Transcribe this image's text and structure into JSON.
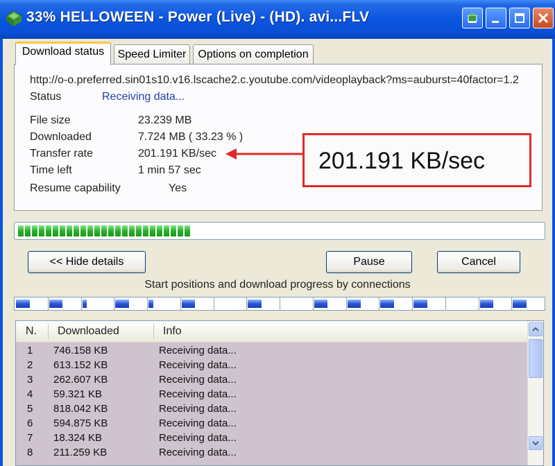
{
  "window": {
    "title": "33% HELLOWEEN - Power (Live) - (HD). avi...FLV"
  },
  "tabs": [
    {
      "label": "Download status",
      "active": true
    },
    {
      "label": "Speed Limiter",
      "active": false
    },
    {
      "label": "Options on completion",
      "active": false
    }
  ],
  "status": {
    "url": "http://o-o.preferred.sin01s10.v16.lscache2.c.youtube.com/videoplayback?ms=auburst=40factor=1.2",
    "status_label": "Status",
    "status_value": "Receiving data...",
    "file_size_label": "File size",
    "file_size_value": "23.239  MB",
    "downloaded_label": "Downloaded",
    "downloaded_value": "7.724  MB  ( 33.23 % )",
    "transfer_rate_label": "Transfer rate",
    "transfer_rate_value": "201.191  KB/sec",
    "time_left_label": "Time left",
    "time_left_value": "1 min 57 sec",
    "resume_label": "Resume capability",
    "resume_value": "Yes"
  },
  "callout": {
    "text": "201.191  KB/sec",
    "color": "#e02a2a"
  },
  "progress": {
    "percent": 33.23,
    "color": "#27b327"
  },
  "buttons": {
    "hide_details": "<< Hide details",
    "pause": "Pause",
    "cancel": "Cancel"
  },
  "connections": {
    "label": "Start positions and download progress by connections"
  },
  "list": {
    "headers": [
      "N.",
      "Downloaded",
      "Info"
    ],
    "rows": [
      {
        "n": "1",
        "downloaded": "746.158  KB",
        "info": "Receiving data..."
      },
      {
        "n": "2",
        "downloaded": "613.152  KB",
        "info": "Receiving data..."
      },
      {
        "n": "3",
        "downloaded": "262.607  KB",
        "info": "Receiving data..."
      },
      {
        "n": "4",
        "downloaded": "59.321  KB",
        "info": "Receiving data..."
      },
      {
        "n": "5",
        "downloaded": "818.042  KB",
        "info": "Receiving data..."
      },
      {
        "n": "6",
        "downloaded": "594.875  KB",
        "info": "Receiving data..."
      },
      {
        "n": "7",
        "downloaded": "18.324  KB",
        "info": "Receiving data..."
      },
      {
        "n": "8",
        "downloaded": "211.259  KB",
        "info": "Receiving data..."
      }
    ]
  },
  "colors": {
    "titlebar": "#0a55e0",
    "face": "#ece9d8",
    "list_bg": "#cec3ce"
  }
}
